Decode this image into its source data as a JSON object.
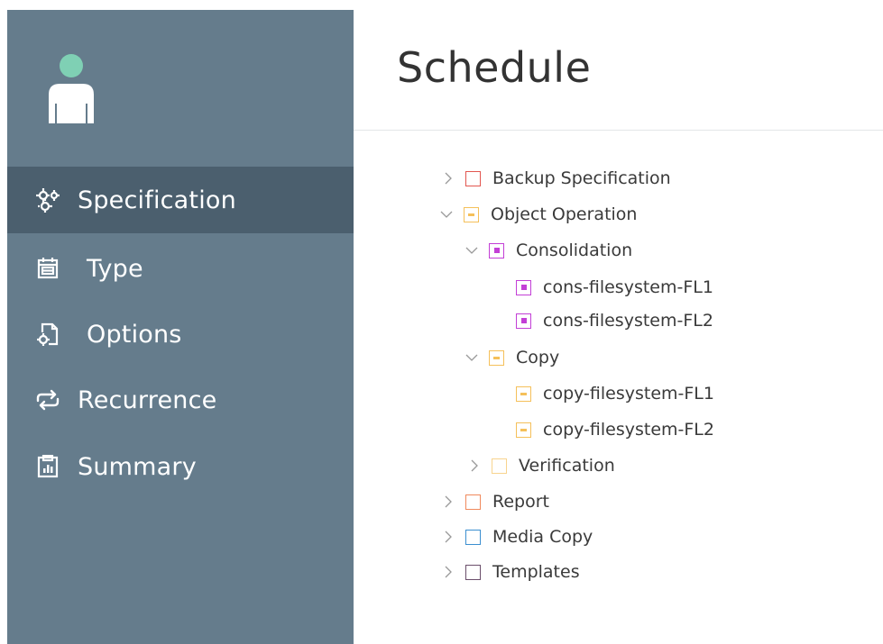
{
  "header": {
    "title": "Schedule"
  },
  "sidebar": {
    "items": [
      {
        "label": "Specification",
        "icon": "gears-icon",
        "active": true
      },
      {
        "label": "Type",
        "icon": "calendar-icon",
        "active": false
      },
      {
        "label": "Options",
        "icon": "document-gear-icon",
        "active": false
      },
      {
        "label": "Recurrence",
        "icon": "repeat-icon",
        "active": false
      },
      {
        "label": "Summary",
        "icon": "clipboard-chart-icon",
        "active": false
      }
    ]
  },
  "tree": {
    "nodes": [
      {
        "label": "Backup Specification",
        "expanded": false,
        "color": "#e2564f"
      },
      {
        "label": "Object Operation",
        "expanded": true,
        "color": "#f5c05a"
      },
      {
        "label": "Consolidation",
        "expanded": true,
        "color": "#c33fd6"
      },
      {
        "label": "cons-filesystem-FL1",
        "color": "#c33fd6"
      },
      {
        "label": "cons-filesystem-FL2",
        "color": "#c33fd6"
      },
      {
        "label": "Copy",
        "expanded": true,
        "color": "#f5c05a"
      },
      {
        "label": "copy-filesystem-FL1",
        "color": "#f5c05a"
      },
      {
        "label": "copy-filesystem-FL2",
        "color": "#f5c05a"
      },
      {
        "label": "Verification",
        "expanded": false,
        "color": "#f8d48e"
      },
      {
        "label": "Report",
        "expanded": false,
        "color": "#f08a5d"
      },
      {
        "label": "Media Copy",
        "expanded": false,
        "color": "#3b8fd0"
      },
      {
        "label": "Templates",
        "expanded": false,
        "color": "#6b4e6b"
      }
    ]
  },
  "colors": {
    "sidebar_bg": "#657c8c",
    "sidebar_active": "#4b5f6e",
    "avatar": "#7fd0b4"
  }
}
